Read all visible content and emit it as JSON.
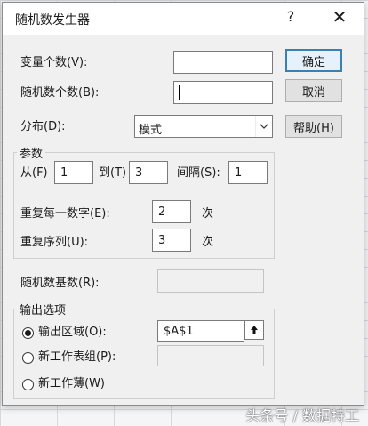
{
  "dialog": {
    "title": "随机数发生器",
    "help_symbol": "?",
    "close_symbol": "✕"
  },
  "fields": {
    "var_count": {
      "label": "变量个数(V):",
      "value": ""
    },
    "rand_count": {
      "label": "随机数个数(B):",
      "value": ""
    },
    "distribution": {
      "label": "分布(D):",
      "value": "模式"
    }
  },
  "buttons": {
    "ok": "确定",
    "cancel": "取消",
    "help": "帮助(H)"
  },
  "params": {
    "title": "参数",
    "from_label": "从(F)",
    "from_value": "1",
    "to_label": "到(T)",
    "to_value": "3",
    "step_label": "间隔(S):",
    "step_value": "1",
    "repeat_each_label": "重复每一数字(E):",
    "repeat_each_value": "2",
    "repeat_seq_label": "重复序列(U):",
    "repeat_seq_value": "3",
    "unit": "次"
  },
  "seed": {
    "label": "随机数基数(R):",
    "value": ""
  },
  "output": {
    "title": "输出选项",
    "range_label": "输出区域(O):",
    "range_value": "$A$1",
    "new_sheet_label": "新工作表组(P):",
    "new_book_label": "新工作薄(W)",
    "selected": "range"
  },
  "watermark": "头条号 / 数据特工"
}
